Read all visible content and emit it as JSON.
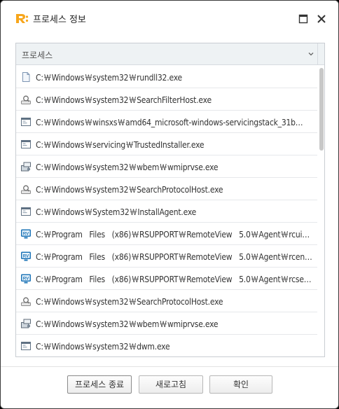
{
  "window": {
    "title": "프로세스 정보",
    "colors": {
      "logo": "#f7a61b",
      "header_bg": "#eef2f4",
      "border": "#c9cdd2"
    }
  },
  "list": {
    "column_header": "프로세스",
    "rows": [
      {
        "icon": "generic-file-icon",
        "path": "C:￦Windows￦system32￦rundll32.exe"
      },
      {
        "icon": "search-service-icon",
        "path": "C:￦Windows￦system32￦SearchFilterHost.exe"
      },
      {
        "icon": "application-window-icon",
        "path": "C:￦Windows￦winsxs￦amd64_microsoft-windows-servicingstack_31b…"
      },
      {
        "icon": "application-window-icon",
        "path": "C:￦Windows￦servicing￦TrustedInstaller.exe"
      },
      {
        "icon": "wmi-provider-icon",
        "path": "C:￦Windows￦system32￦wbem￦wmiprvse.exe"
      },
      {
        "icon": "search-service-icon",
        "path": "C:￦Windows￦system32￦SearchProtocolHost.exe"
      },
      {
        "icon": "application-window-icon",
        "path": "C:￦Windows￦System32￦InstallAgent.exe"
      },
      {
        "icon": "rv-app-icon",
        "path": "C:￦Program   Files   (x86)￦RSUPPORT￦RemoteView   5.0￦Agent￦rcuim…"
      },
      {
        "icon": "rv-app-icon",
        "path": "C:￦Program   Files   (x86)￦RSUPPORT￦RemoteView   5.0￦Agent￦rceng…"
      },
      {
        "icon": "rv-app-icon",
        "path": "C:￦Program   Files   (x86)￦RSUPPORT￦RemoteView   5.0￦Agent￦rcsem…"
      },
      {
        "icon": "search-service-icon",
        "path": "C:￦Windows￦system32￦SearchProtocolHost.exe"
      },
      {
        "icon": "wmi-provider-icon",
        "path": "C:￦Windows￦system32￦wbem￦wmiprvse.exe"
      },
      {
        "icon": "application-window-icon",
        "path": "C:￦Windows￦system32￦dwm.exe"
      }
    ]
  },
  "buttons": {
    "end_process": "프로세스 종료",
    "refresh": "새로고침",
    "ok": "확인"
  }
}
